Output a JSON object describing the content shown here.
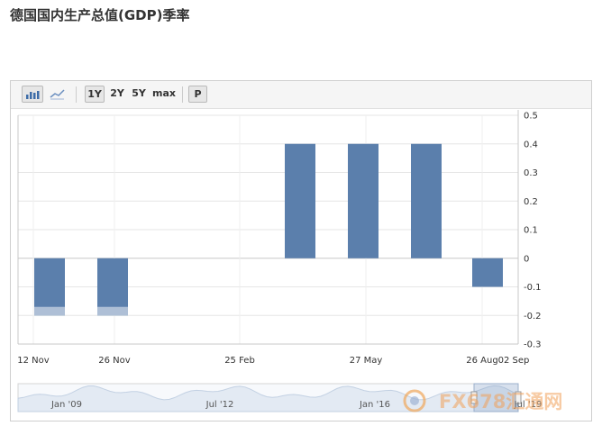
{
  "page": {
    "title": "德国国内生产总值(GDP)季率"
  },
  "toolbar": {
    "bar_chart_icon": "bar-chart-icon",
    "line_chart_icon": "line-chart-icon",
    "ranges": [
      "1Y",
      "2Y",
      "5Y",
      "max"
    ],
    "active_range": "1Y",
    "print_label": "P"
  },
  "chart_data": {
    "type": "bar",
    "categories": [
      "12 Nov",
      "26 Nov",
      "25 Feb",
      "27 May",
      "26 Aug",
      "02 Sep"
    ],
    "bars": [
      {
        "x_label": "12 Nov",
        "value": -0.2,
        "color": "#5b7fac",
        "highlight": -0.17
      },
      {
        "x_label": "26 Nov",
        "value": -0.2,
        "color": "#5b7fac",
        "highlight": -0.17
      },
      {
        "x_label": "25 Feb",
        "value": 0.4,
        "color": "#5b7fac"
      },
      {
        "x_label": "27 May",
        "value": 0.4,
        "color": "#5b7fac"
      },
      {
        "x_label": "26 Aug",
        "value": 0.4,
        "color": "#5b7fac"
      },
      {
        "x_label": "02 Sep",
        "value": -0.1,
        "color": "#5b7fac"
      }
    ],
    "yticks": [
      0.5,
      0.4,
      0.3,
      0.2,
      0.1,
      0,
      -0.1,
      -0.2,
      -0.3
    ],
    "ylim": [
      -0.3,
      0.5
    ],
    "grid": true,
    "ylabel": "",
    "xlabel": "",
    "title": ""
  },
  "navigator": {
    "labels": [
      "Jan '09",
      "Jul '12",
      "Jan '16",
      "Jul '19"
    ]
  },
  "watermark": {
    "text": "FX678汇通网"
  },
  "colors": {
    "bar": "#5b7fac",
    "bar_light": "#aebfd6",
    "grid": "#e6e6e6"
  }
}
